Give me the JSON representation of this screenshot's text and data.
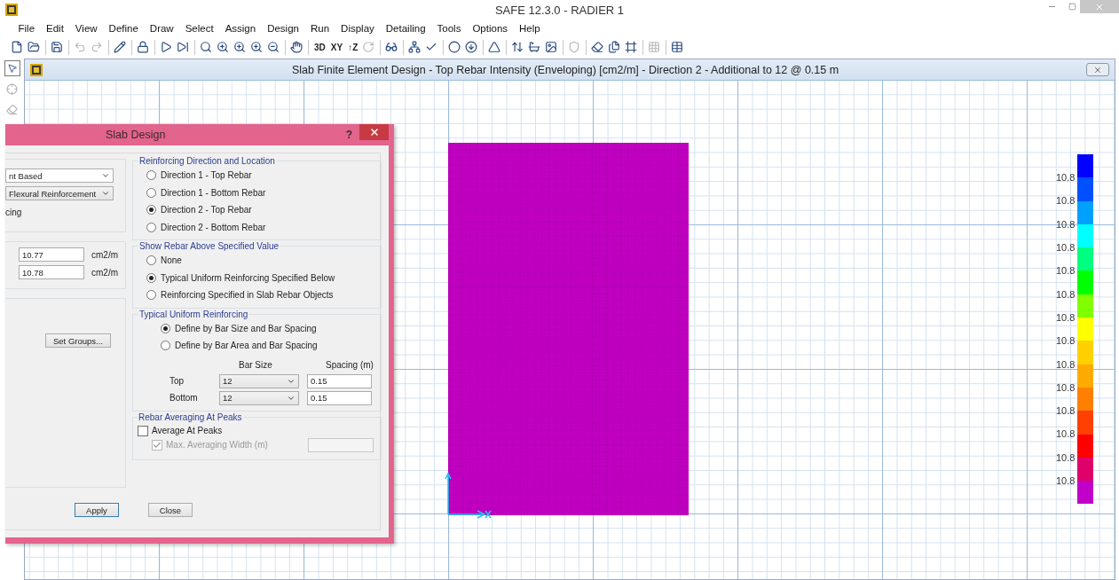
{
  "window": {
    "title": "SAFE 12.3.0 - RADIER 1"
  },
  "menu": [
    "File",
    "Edit",
    "View",
    "Define",
    "Draw",
    "Select",
    "Assign",
    "Design",
    "Run",
    "Display",
    "Detailing",
    "Tools",
    "Options",
    "Help"
  ],
  "toolbar": [
    {
      "kind": "icon",
      "disabled": false
    },
    {
      "kind": "icon",
      "disabled": false
    },
    {
      "kind": "separator"
    },
    {
      "kind": "icon",
      "disabled": false
    },
    {
      "kind": "separator"
    },
    {
      "kind": "icon",
      "disabled": true
    },
    {
      "kind": "icon",
      "disabled": true
    },
    {
      "kind": "separator"
    },
    {
      "kind": "icon",
      "disabled": false
    },
    {
      "kind": "separator"
    },
    {
      "kind": "icon",
      "disabled": false
    },
    {
      "kind": "separator"
    },
    {
      "kind": "icon",
      "disabled": false
    },
    {
      "kind": "icon",
      "disabled": false
    },
    {
      "kind": "separator"
    },
    {
      "kind": "icon",
      "disabled": false
    },
    {
      "kind": "icon",
      "disabled": false
    },
    {
      "kind": "icon",
      "disabled": false
    },
    {
      "kind": "icon",
      "disabled": false
    },
    {
      "kind": "icon",
      "disabled": false
    },
    {
      "kind": "separator"
    },
    {
      "kind": "icon",
      "disabled": false
    },
    {
      "kind": "separator"
    },
    {
      "kind": "label",
      "label": "3D"
    },
    {
      "kind": "label",
      "label": "XY"
    },
    {
      "kind": "label",
      "label": "↑Z"
    },
    {
      "kind": "icon",
      "disabled": true
    },
    {
      "kind": "separator"
    },
    {
      "kind": "icon",
      "disabled": false
    },
    {
      "kind": "separator"
    },
    {
      "kind": "icon",
      "disabled": false
    },
    {
      "kind": "icon",
      "disabled": false
    },
    {
      "kind": "separator"
    },
    {
      "kind": "icon",
      "disabled": false
    },
    {
      "kind": "icon",
      "disabled": false
    },
    {
      "kind": "separator"
    },
    {
      "kind": "icon",
      "disabled": false
    },
    {
      "kind": "separator"
    },
    {
      "kind": "icon",
      "disabled": false
    },
    {
      "kind": "icon",
      "disabled": false
    },
    {
      "kind": "icon",
      "disabled": false
    },
    {
      "kind": "separator"
    },
    {
      "kind": "icon",
      "disabled": true
    },
    {
      "kind": "separator"
    },
    {
      "kind": "icon",
      "disabled": false
    },
    {
      "kind": "icon",
      "disabled": false
    },
    {
      "kind": "icon",
      "disabled": false
    },
    {
      "kind": "separator"
    },
    {
      "kind": "icon",
      "disabled": true
    },
    {
      "kind": "separator"
    },
    {
      "kind": "icon",
      "disabled": false
    }
  ],
  "child_window": {
    "title": "Slab Finite Element Design - Top Rebar Intensity (Enveloping) [cm2/m] - Direction 2 - Additional to 12 @ 0.15 m"
  },
  "legend": {
    "labels": [
      "10.8",
      "10.8",
      "10.8",
      "10.8",
      "10.8",
      "10.8",
      "10.8",
      "10.8",
      "10.8",
      "10.8",
      "10.8",
      "10.8",
      "10.8",
      "10.8"
    ],
    "segments": [
      {
        "color": "#0000ff"
      },
      {
        "color": "#0050ff"
      },
      {
        "color": "#00a0ff"
      },
      {
        "color": "#00ffff"
      },
      {
        "color": "#00ff80"
      },
      {
        "color": "#00ff00"
      },
      {
        "color": "#80ff00"
      },
      {
        "color": "#ffff00"
      },
      {
        "color": "#ffd000"
      },
      {
        "color": "#ffaa00"
      },
      {
        "color": "#ff8000"
      },
      {
        "color": "#ff4000"
      },
      {
        "color": "#ff0000"
      },
      {
        "color": "#e0006a"
      },
      {
        "color": "#c000c8"
      }
    ]
  },
  "dialog": {
    "title": "Slab Design",
    "help": "?",
    "left": {
      "dropdowns": [
        "nt Based",
        "Flexural Reinforcement"
      ],
      "note": "cing",
      "fields": [
        {
          "value": "10.77",
          "unit": "cm2/m"
        },
        {
          "value": "10.78",
          "unit": "cm2/m"
        }
      ],
      "button": "Set Groups..."
    },
    "direction_group": {
      "title": "Reinforcing Direction and Location",
      "options": [
        {
          "label": "Direction 1 - Top Rebar",
          "selected": false
        },
        {
          "label": "Direction 1 - Bottom Rebar",
          "selected": false
        },
        {
          "label": "Direction 2 - Top Rebar",
          "selected": true
        },
        {
          "label": "Direction 2 - Bottom Rebar",
          "selected": false
        }
      ]
    },
    "show_group": {
      "title": "Show Rebar Above Specified Value",
      "options": [
        {
          "label": "None",
          "selected": false
        },
        {
          "label": "Typical Uniform Reinforcing Specified Below",
          "selected": true
        },
        {
          "label": "Reinforcing Specified in Slab Rebar Objects",
          "selected": false
        }
      ]
    },
    "typical_group": {
      "title": "Typical Uniform Reinforcing",
      "options": [
        {
          "label": "Define by Bar Size and Bar Spacing",
          "selected": true
        },
        {
          "label": "Define by Bar Area and Bar Spacing",
          "selected": false
        }
      ],
      "headers": [
        "Bar Size",
        "Spacing  (m)"
      ],
      "rows": [
        {
          "label": "Top",
          "bar_size": "12",
          "spacing": "0.15"
        },
        {
          "label": "Bottom",
          "bar_size": "12",
          "spacing": "0.15"
        }
      ]
    },
    "averaging_group": {
      "title": "Rebar Averaging At Peaks",
      "checks": [
        {
          "label": "Average At Peaks",
          "checked": false,
          "disabled": false
        },
        {
          "label": "Max. Averaging Width  (m)",
          "checked": true,
          "disabled": true
        }
      ]
    },
    "buttons": [
      {
        "label": "Apply",
        "default": true
      },
      {
        "label": "Close",
        "default": false
      }
    ]
  }
}
